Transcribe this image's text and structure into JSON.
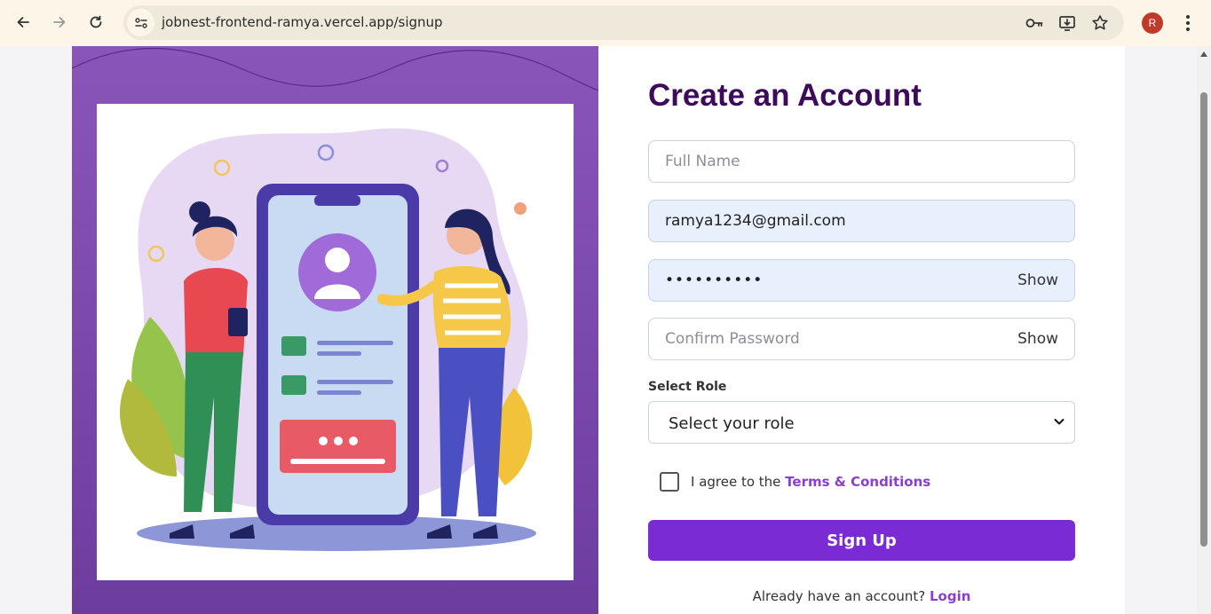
{
  "browser": {
    "url": "jobnest-frontend-ramya.vercel.app/signup",
    "profile_initial": "R"
  },
  "form": {
    "title": "Create an Account",
    "full_name_placeholder": "Full Name",
    "email_value": "ramya1234@gmail.com",
    "password_value": "••••••••••",
    "password_show": "Show",
    "confirm_placeholder": "Confirm Password",
    "confirm_show": "Show",
    "role_label": "Select Role",
    "role_selected": "Select your role",
    "agree_text": "I agree to the ",
    "terms_link": "Terms & Conditions",
    "signup_label": "Sign Up",
    "have_account_text": "Already have an account? ",
    "login_link": "Login"
  },
  "colors": {
    "brand": "#7b2bd3",
    "title": "#3d0a5c",
    "panel": "#8a55b8"
  }
}
